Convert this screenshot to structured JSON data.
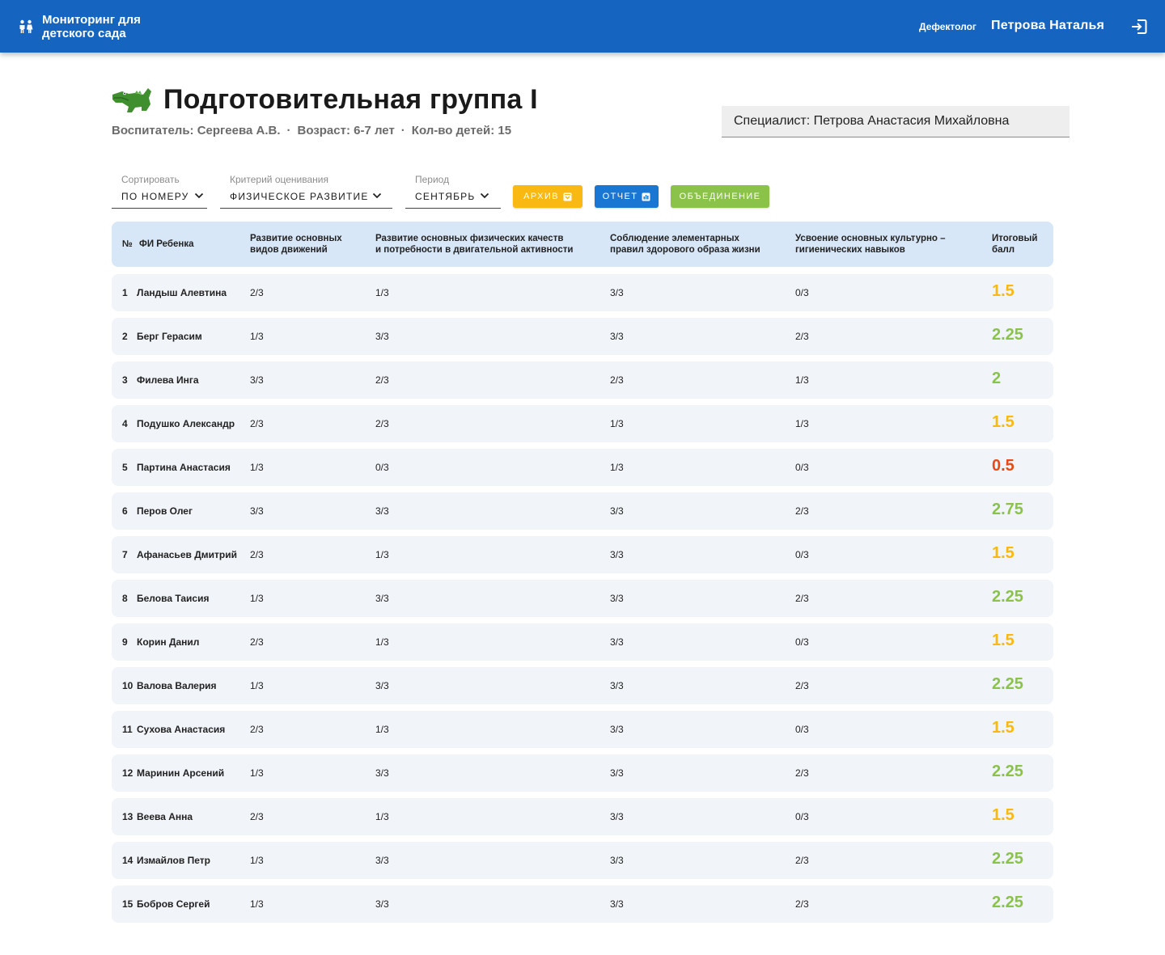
{
  "header": {
    "app_title": "Мониторинг для детского сада",
    "role": "Дефектолог",
    "user_name": "Петрова Наталья",
    "brand_icon": "children-icon",
    "logout_icon": "logout-icon"
  },
  "group": {
    "icon": "crocodile-icon",
    "title": "Подготовительная группа I",
    "teacher": "Воспитатель: Сергеева А.В.",
    "age": "Возраст: 6-7 лет",
    "count": "Кол-во детей: 15",
    "separator": "·"
  },
  "specialist": "Специалист: Петрова Анастасия Михайловна",
  "filters": {
    "sort": {
      "label": "Сортировать",
      "value": "ПО НОМЕРУ"
    },
    "criterion": {
      "label": "Критерий оценивания",
      "value": "ФИЗИЧЕСКОЕ РАЗВИТИЕ"
    },
    "period": {
      "label": "Период",
      "value": "СЕНТЯБРЬ"
    }
  },
  "actions": {
    "archive": "АРХИВ",
    "report": "ОТЧЕТ",
    "merge": "ОБЪЕДИНЕНИЕ"
  },
  "colors": {
    "header_bg": "#1565c0",
    "archive": "#f9b812",
    "report": "#1976d2",
    "merge": "#8bc34a",
    "score_high": "#8bc34a",
    "score_mid": "#f9b812",
    "score_low": "#e64a19"
  },
  "table": {
    "columns": {
      "num": "№",
      "name": "ФИ Ребенка",
      "c1_line1": "Развитие основных",
      "c1_line2": "видов движений",
      "c2_line1": "Развитие основных физических качеств",
      "c2_line2": "и потребности в двигательной активности",
      "c3_line1": "Соблюдение элементарных",
      "c3_line2": "правил здорового образа жизни",
      "c4_line1": "Усвоение основных культурно –",
      "c4_line2": "гигиенических навыков",
      "total_line1": "Итоговый",
      "total_line2": "балл"
    },
    "rows": [
      {
        "num": "1",
        "name": "Ландыш Алевтина",
        "c1": "2/3",
        "c2": "1/3",
        "c3": "3/3",
        "c4": "0/3",
        "total": "1.5",
        "level": "mid"
      },
      {
        "num": "2",
        "name": "Берг Герасим",
        "c1": "1/3",
        "c2": "3/3",
        "c3": "3/3",
        "c4": "2/3",
        "total": "2.25",
        "level": "high"
      },
      {
        "num": "3",
        "name": "Филева Инга",
        "c1": "3/3",
        "c2": "2/3",
        "c3": "2/3",
        "c4": "1/3",
        "total": "2",
        "level": "high"
      },
      {
        "num": "4",
        "name": "Подушко Александр",
        "c1": "2/3",
        "c2": "2/3",
        "c3": "1/3",
        "c4": "1/3",
        "total": "1.5",
        "level": "mid"
      },
      {
        "num": "5",
        "name": "Партина Анастасия",
        "c1": "1/3",
        "c2": "0/3",
        "c3": "1/3",
        "c4": "0/3",
        "total": "0.5",
        "level": "low"
      },
      {
        "num": "6",
        "name": "Перов Олег",
        "c1": "3/3",
        "c2": "3/3",
        "c3": "3/3",
        "c4": "2/3",
        "total": "2.75",
        "level": "high"
      },
      {
        "num": "7",
        "name": "Афанасьев Дмитрий",
        "c1": "2/3",
        "c2": "1/3",
        "c3": "3/3",
        "c4": "0/3",
        "total": "1.5",
        "level": "mid"
      },
      {
        "num": "8",
        "name": "Белова Таисия",
        "c1": "1/3",
        "c2": "3/3",
        "c3": "3/3",
        "c4": "2/3",
        "total": "2.25",
        "level": "high"
      },
      {
        "num": "9",
        "name": "Корин Данил",
        "c1": "2/3",
        "c2": "1/3",
        "c3": "3/3",
        "c4": "0/3",
        "total": "1.5",
        "level": "mid"
      },
      {
        "num": "10",
        "name": "Валова Валерия",
        "c1": "1/3",
        "c2": "3/3",
        "c3": "3/3",
        "c4": "2/3",
        "total": "2.25",
        "level": "high"
      },
      {
        "num": "11",
        "name": "Сухова Анастасия",
        "c1": "2/3",
        "c2": "1/3",
        "c3": "3/3",
        "c4": "0/3",
        "total": "1.5",
        "level": "mid"
      },
      {
        "num": "12",
        "name": "Маринин Арсений",
        "c1": "1/3",
        "c2": "3/3",
        "c3": "3/3",
        "c4": "2/3",
        "total": "2.25",
        "level": "high"
      },
      {
        "num": "13",
        "name": "Веева Анна",
        "c1": "2/3",
        "c2": "1/3",
        "c3": "3/3",
        "c4": "0/3",
        "total": "1.5",
        "level": "mid"
      },
      {
        "num": "14",
        "name": "Измайлов Петр",
        "c1": "1/3",
        "c2": "3/3",
        "c3": "3/3",
        "c4": "2/3",
        "total": "2.25",
        "level": "high"
      },
      {
        "num": "15",
        "name": "Бобров Сергей",
        "c1": "1/3",
        "c2": "3/3",
        "c3": "3/3",
        "c4": "2/3",
        "total": "2.25",
        "level": "high"
      }
    ]
  }
}
